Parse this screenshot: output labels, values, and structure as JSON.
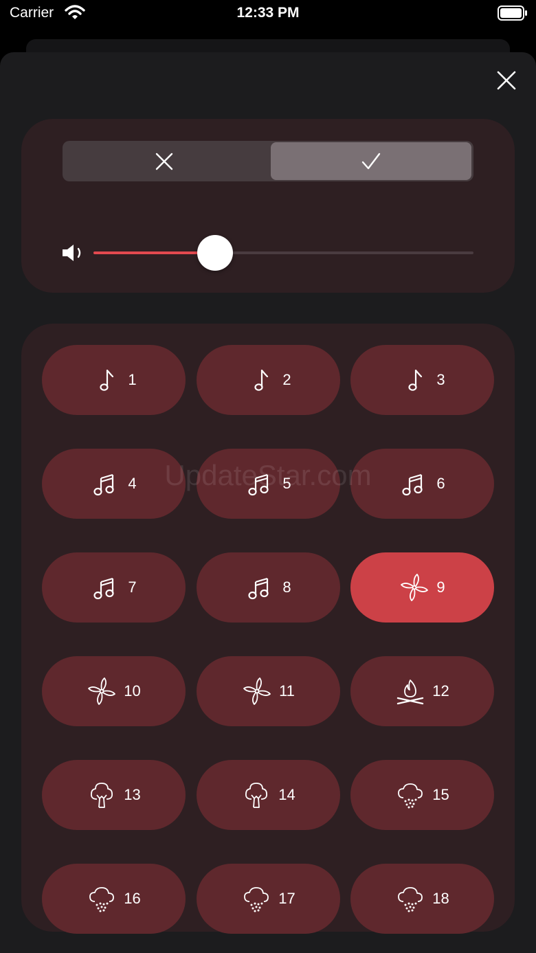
{
  "status_bar": {
    "carrier": "Carrier",
    "time": "12:33 PM"
  },
  "volume": {
    "level": 0.32
  },
  "sounds": [
    {
      "label": "1",
      "icon": "music-note-icon",
      "selected": false
    },
    {
      "label": "2",
      "icon": "music-note-icon",
      "selected": false
    },
    {
      "label": "3",
      "icon": "music-note-icon",
      "selected": false
    },
    {
      "label": "4",
      "icon": "music-notes-icon",
      "selected": false
    },
    {
      "label": "5",
      "icon": "music-notes-icon",
      "selected": false
    },
    {
      "label": "6",
      "icon": "music-notes-icon",
      "selected": false
    },
    {
      "label": "7",
      "icon": "music-notes-icon",
      "selected": false
    },
    {
      "label": "8",
      "icon": "music-notes-icon",
      "selected": false
    },
    {
      "label": "9",
      "icon": "fan-icon",
      "selected": true
    },
    {
      "label": "10",
      "icon": "fan-icon",
      "selected": false
    },
    {
      "label": "11",
      "icon": "fan-icon",
      "selected": false
    },
    {
      "label": "12",
      "icon": "campfire-icon",
      "selected": false
    },
    {
      "label": "13",
      "icon": "tree-icon",
      "selected": false
    },
    {
      "label": "14",
      "icon": "tree-icon",
      "selected": false
    },
    {
      "label": "15",
      "icon": "rain-cloud-icon",
      "selected": false
    },
    {
      "label": "16",
      "icon": "rain-cloud-icon",
      "selected": false
    },
    {
      "label": "17",
      "icon": "rain-cloud-icon",
      "selected": false
    },
    {
      "label": "18",
      "icon": "rain-cloud-icon",
      "selected": false
    }
  ],
  "watermark": "UpdateStar.com",
  "colors": {
    "accent": "#e2494f",
    "selected_button": "#cc4147",
    "button": "#5f282d",
    "card": "#2e1f22"
  }
}
